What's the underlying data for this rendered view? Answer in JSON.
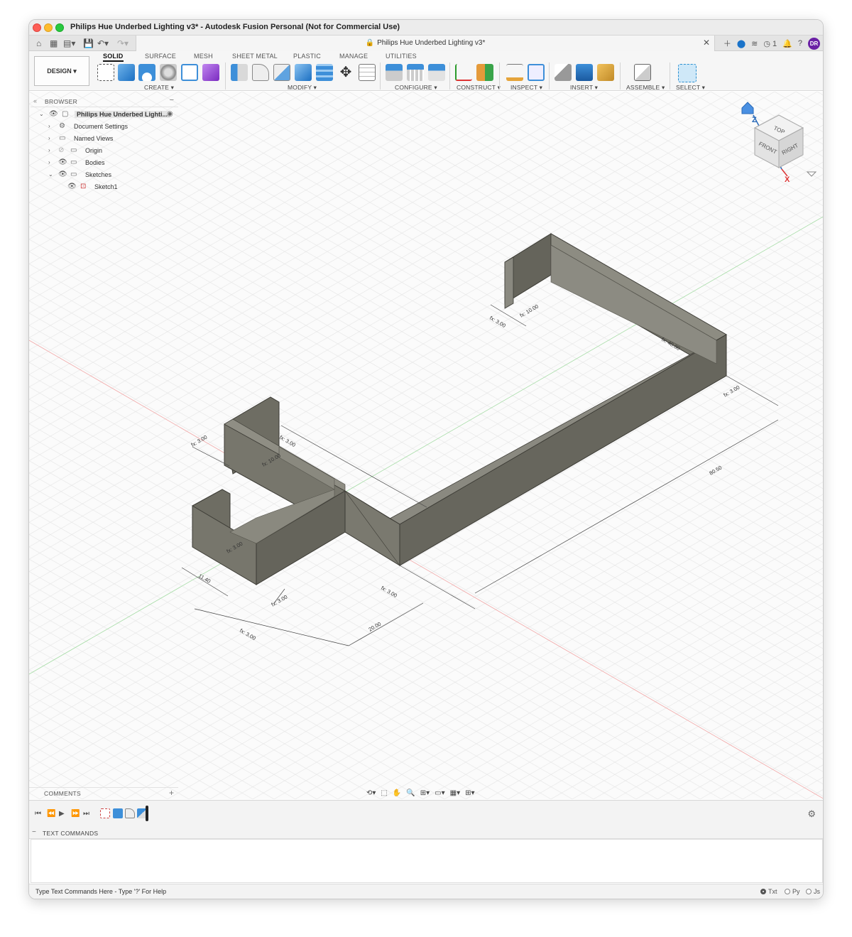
{
  "window": {
    "title": "Philips Hue Underbed Lighting v3* - Autodesk Fusion Personal (Not for Commercial Use)"
  },
  "tabbar": {
    "doc_tab_title": "Philips Hue Underbed Lighting v3*",
    "job_count": "1",
    "user_initials": "DR"
  },
  "toolbar": {
    "workspace_button": "DESIGN ▾",
    "tabs": [
      "SOLID",
      "SURFACE",
      "MESH",
      "SHEET METAL",
      "PLASTIC",
      "MANAGE",
      "UTILITIES"
    ],
    "active_tab": "SOLID",
    "groups": [
      "CREATE ▾",
      "MODIFY ▾",
      "CONFIGURE ▾",
      "CONSTRUCT ▾",
      "INSPECT ▾",
      "INSERT ▾",
      "ASSEMBLE ▾",
      "SELECT ▾"
    ]
  },
  "browser": {
    "header": "BROWSER",
    "items": [
      {
        "label": "Philips Hue Underbed Lighti...",
        "icon": "component-icon"
      },
      {
        "label": "Document Settings",
        "icon": "gear-icon"
      },
      {
        "label": "Named Views",
        "icon": "folder-icon"
      },
      {
        "label": "Origin",
        "icon": "folder-icon"
      },
      {
        "label": "Bodies",
        "icon": "folder-icon"
      },
      {
        "label": "Sketches",
        "icon": "folder-icon"
      },
      {
        "label": "Sketch1",
        "icon": "sketch-icon"
      }
    ]
  },
  "viewcube": {
    "faces": [
      "TOP",
      "FRONT",
      "RIGHT"
    ],
    "axes": [
      "Z",
      "X"
    ]
  },
  "dimensions": [
    "fx: 3.00",
    "fx: 10.00",
    "fx: 40.00",
    "fx: 3.00",
    "80.50",
    "fx: 3.00",
    "fx: 3.00",
    "fx: 10.00",
    "fx: 3.00",
    "11.40",
    "fx: 3.00",
    "20.00",
    "fx: 3.00",
    "fx: 3.00"
  ],
  "comments": {
    "header": "COMMENTS"
  },
  "text_commands": {
    "header": "TEXT COMMANDS",
    "placeholder": "Type Text Commands Here - Type '?' For Help",
    "modes": [
      "Txt",
      "Py",
      "Js"
    ],
    "selected_mode": "Txt"
  },
  "colors": {
    "body_fill": "#6b6a60",
    "body_top": "#8c8b80",
    "accent_blue": "#1a73c9",
    "avatar": "#6a1fa5"
  }
}
